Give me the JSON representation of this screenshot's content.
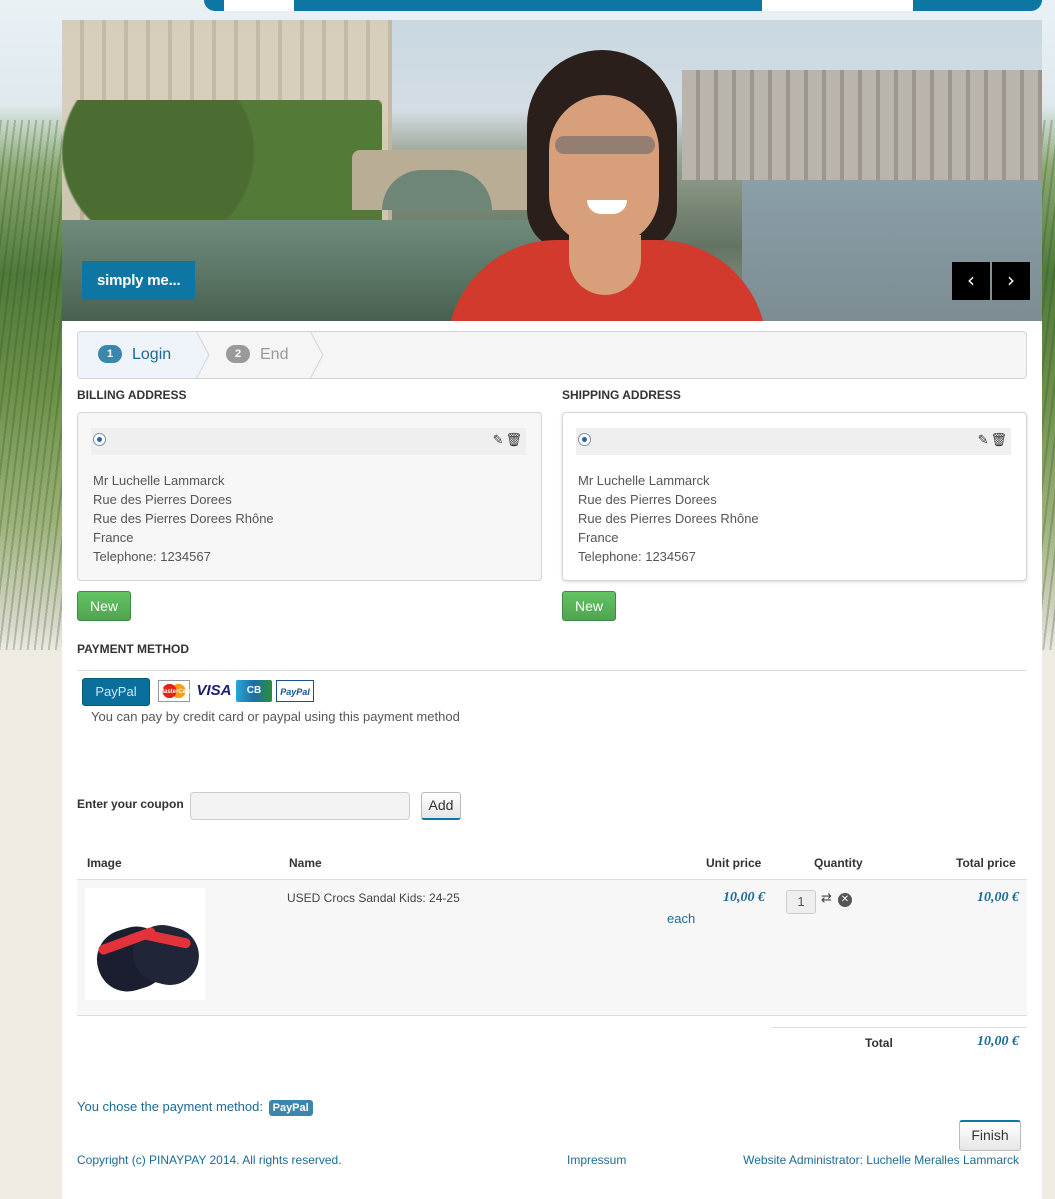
{
  "hero": {
    "caption": "simply me...",
    "prev_icon": "‹",
    "next_icon": "›"
  },
  "wizard": {
    "steps": [
      {
        "num": "1",
        "label": "Login"
      },
      {
        "num": "2",
        "label": "End"
      }
    ]
  },
  "billing": {
    "title": "BILLING ADDRESS",
    "lines": [
      "Mr Luchelle Lammarck",
      "Rue des Pierres Dorees",
      "Rue des Pierres Dorees Rhône",
      "France",
      "Telephone: 1234567"
    ],
    "new_label": "New"
  },
  "shipping": {
    "title": "SHIPPING ADDRESS",
    "lines": [
      "Mr Luchelle Lammarck",
      "Rue des Pierres Dorees",
      "Rue des Pierres Dorees Rhône",
      "France",
      "Telephone: 1234567"
    ],
    "new_label": "New"
  },
  "payment": {
    "title": "PAYMENT METHOD",
    "paypal_label": "PayPal",
    "cards": [
      "MasterCard",
      "VISA",
      "CB",
      "PayPal"
    ],
    "description": "You can pay by credit card or paypal using this payment method"
  },
  "coupon": {
    "label": "Enter your coupon",
    "value": "",
    "add_label": "Add"
  },
  "cart": {
    "headers": {
      "image": "Image",
      "name": "Name",
      "unit_price": "Unit price",
      "quantity": "Quantity",
      "total_price": "Total price"
    },
    "items": [
      {
        "name": "USED Crocs Sandal Kids: 24-25",
        "unit_price": "10,00 €",
        "each": "each",
        "quantity": "1",
        "total_price": "10,00 €"
      }
    ],
    "total_label": "Total",
    "total_value": "10,00 €"
  },
  "chosen": {
    "text": "You chose the payment method:",
    "method": "PayPal"
  },
  "finish_label": "Finish",
  "footer": {
    "copyright": "Copyright (c) PINAYPAY 2014. All rights reserved.",
    "impressum": "Impressum",
    "admin": "Website Administrator: Luchelle Meralles Lammarck"
  },
  "colors": {
    "accent": "#0e76a3",
    "link": "#1a6b96",
    "green": "#51a351"
  }
}
